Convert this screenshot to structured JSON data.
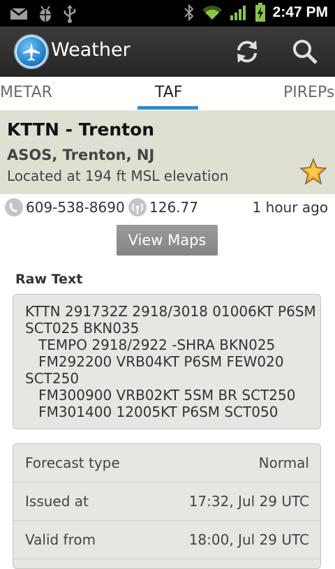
{
  "status_bar": {
    "time": "2:47 PM",
    "icons": [
      "gmail-icon",
      "android-debug-icon",
      "usb-icon",
      "bluetooth-icon",
      "wifi-icon",
      "signal-icon",
      "battery-charging-icon"
    ]
  },
  "action_bar": {
    "title": "Weather",
    "icons": [
      "app-logo-icon",
      "refresh-icon",
      "search-icon"
    ]
  },
  "tabs": [
    {
      "label": "METAR",
      "selected": false
    },
    {
      "label": "TAF",
      "selected": true
    },
    {
      "label": "PIREPs",
      "selected": false
    }
  ],
  "station": {
    "title": "KTTN - Trenton",
    "subtitle": "ASOS, Trenton, NJ",
    "elevation": "Located at 194 ft MSL elevation",
    "favorite": true
  },
  "contact": {
    "phone": "609-538-8690",
    "frequency": "126.77",
    "age": "1 hour ago"
  },
  "view_maps_label": "View Maps",
  "raw": {
    "label": "Raw Text",
    "lines": [
      "KTTN 291732Z 2918/3018 01006KT P6SM",
      "SCT025 BKN035",
      "   TEMPO 2918/2922 -SHRA BKN025",
      "   FM292200 VRB04KT P6SM FEW020",
      "SCT250",
      "   FM300900 VRB02KT 5SM BR SCT250",
      "   FM301400 12005KT P6SM SCT050"
    ]
  },
  "details": [
    {
      "label": "Forecast type",
      "value": "Normal"
    },
    {
      "label": "Issued at",
      "value": "17:32, Jul 29 UTC"
    },
    {
      "label": "Valid from",
      "value": "18:00, Jul 29 UTC"
    }
  ],
  "colors": {
    "accent": "#2e8fc9",
    "station_bg": "#dfe0d4",
    "box_bg": "#e6e6e2"
  }
}
